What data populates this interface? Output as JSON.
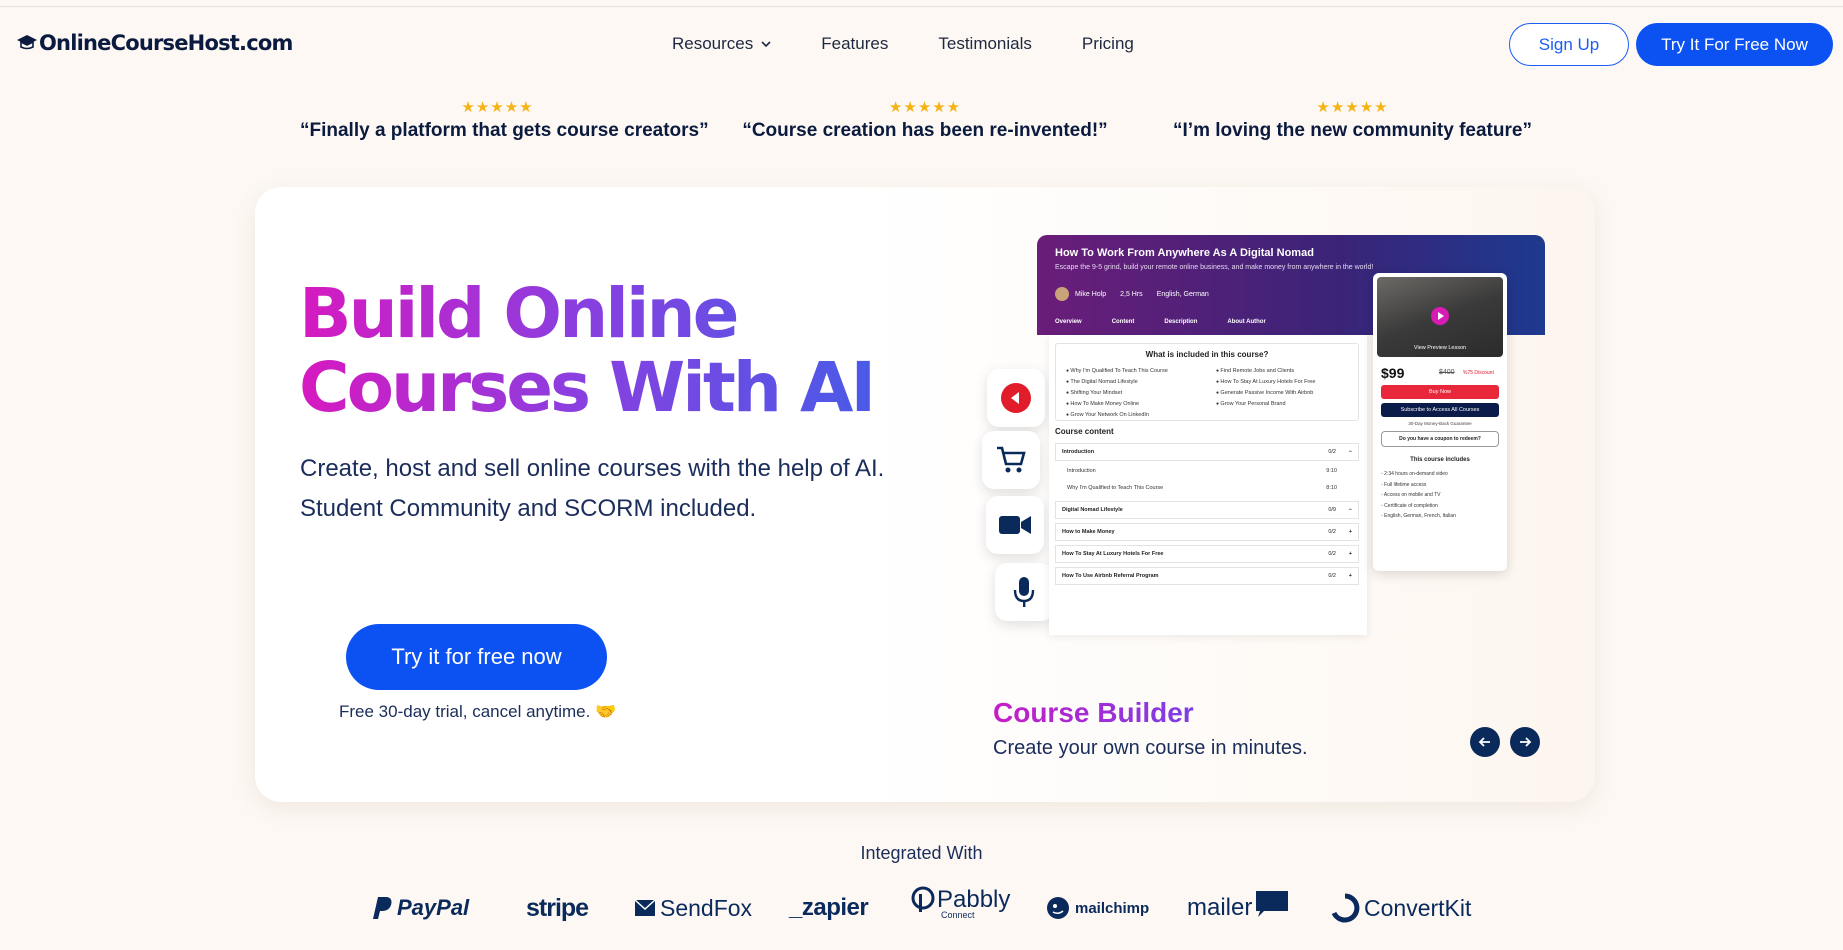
{
  "header": {
    "logo_text": "OnlineCourseHost.com",
    "nav": [
      {
        "label": "Resources"
      },
      {
        "label": "Features"
      },
      {
        "label": "Testimonials"
      },
      {
        "label": "Pricing"
      }
    ],
    "signup_label": "Sign Up",
    "try_label": "Try It For Free Now"
  },
  "testimonials": [
    {
      "stars": "★★★★★",
      "quote": "“Finally a platform that gets course creators”"
    },
    {
      "stars": "★★★★★",
      "quote": "“Course creation has been re-invented!”"
    },
    {
      "stars": "★★★★★",
      "quote": "“I’m loving the new community feature”"
    }
  ],
  "hero": {
    "title": "Build Online Courses With AI",
    "subtitle": "Create, host and sell online courses with the help of AI. Student Community and SCORM included.",
    "cta": "Try it for free now",
    "note": "Free 30-day trial, cancel anytime. 🤝"
  },
  "feature_icons": [
    "youtube-icon",
    "cart-icon",
    "video-camera-icon",
    "microphone-icon"
  ],
  "mock": {
    "title": "How To Work From Anywhere As A Digital Nomad",
    "desc": "Escape the 9-5 grind, build your remote online business, and make money from anywhere in the world!",
    "author": "Mike Holp",
    "duration": "2,5 Hrs",
    "languages": "English, German",
    "tabs": [
      "Overview",
      "Content",
      "Description",
      "About Author"
    ],
    "included_title": "What is included in this course?",
    "included_left": [
      "Why I'm Qualified To Teach This Course",
      "The Digital Nomad Lifestyle",
      "Shifting Your Mindset",
      "How To Make Money Online",
      "Grow Your Network On LinkedIn"
    ],
    "included_right": [
      "Find Remote Jobs and Clients",
      "How To Stay At Luxury Hotels For Free",
      "Generate Passive Income With Airbnb",
      "Grow Your Personal Brand"
    ],
    "course_content_title": "Course content",
    "sections": [
      {
        "label": "Introduction",
        "count": "0/2",
        "sign": "−"
      },
      {
        "label": "Digital Nomad Lifestyle",
        "count": "0/9",
        "sign": "−"
      },
      {
        "label": "How to Make Money",
        "count": "0/2",
        "sign": "+"
      },
      {
        "label": "How To Stay At Luxury Hotels For Free",
        "count": "0/2",
        "sign": "+"
      },
      {
        "label": "How To Use Airbnb Referral Program",
        "count": "0/2",
        "sign": "+"
      }
    ],
    "lessons": [
      {
        "label": "Introduction",
        "time": "9:10"
      },
      {
        "label": "Why I'm Qualified to Teach This Course",
        "time": "8:10"
      }
    ],
    "preview_label": "View Preview Lesson",
    "price": "$99",
    "old_price": "$400",
    "discount": "%75 Discount",
    "buy_label": "Buy Now",
    "subscribe_label": "Subscribe to Access All Courses",
    "guarantee": "30-Day Money-Back Guarantee",
    "coupon_label": "Do you have a coupon to redeem?",
    "includes_title": "This course includes",
    "includes": [
      "2:34 hours on-demand video",
      "Full lifetime access",
      "Access on mobile and TV",
      "Certificate of completion",
      "English, German, French, Italian"
    ]
  },
  "builder": {
    "title": "Course Builder",
    "subtitle": "Create your own course in minutes."
  },
  "integrations": {
    "title": "Integrated With",
    "logos": [
      "PayPal",
      "stripe",
      "SendFox",
      "_zapier",
      "Pabbly",
      "Connect",
      "mailchimp",
      "mailer",
      "ConvertKit"
    ]
  },
  "colors": {
    "primary_blue": "#0c52f2",
    "navy": "#0b1b3f",
    "star": "#f5b416",
    "gradient_start": "#d719c0",
    "gradient_end": "#3f5fe8"
  }
}
